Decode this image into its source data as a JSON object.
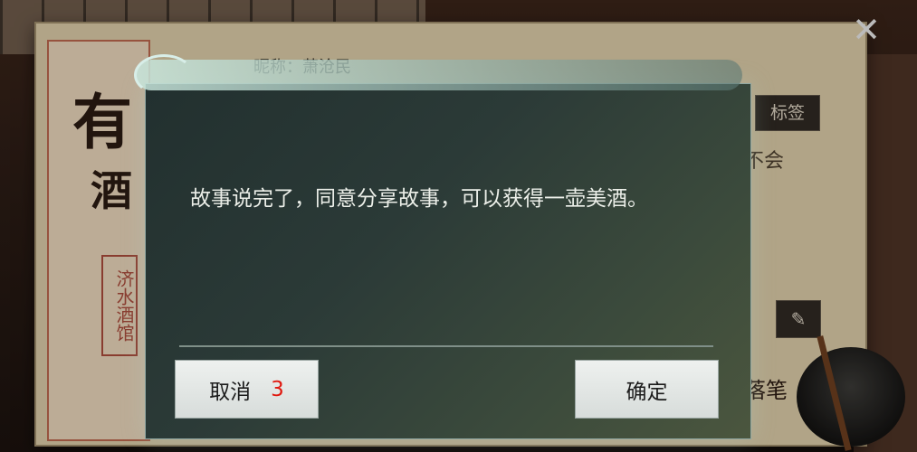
{
  "background": {
    "nickname_label": "昵称：萧沧民",
    "big_chars": [
      "有",
      "酒"
    ],
    "seal_text": "济水酒馆",
    "tag_button": "标签",
    "partial_text": "不会",
    "write_label": "落笔"
  },
  "dialog": {
    "message": "故事说完了，同意分享故事，可以获得一壶美酒。",
    "cancel_label": "取消",
    "cancel_countdown": "3",
    "confirm_label": "确定"
  },
  "icons": {
    "close": "close-icon",
    "eraser": "eraser-icon"
  }
}
